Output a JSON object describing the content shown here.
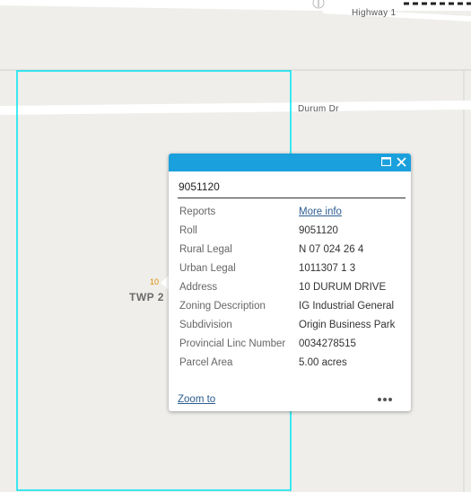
{
  "map": {
    "road_highway_label": "Highway 1",
    "road_durum_label": "Durum Dr",
    "township_label": "TWP 2",
    "lot_number": "10"
  },
  "popup": {
    "title": "9051120",
    "zoom_to_label": "Zoom to",
    "attributes": [
      {
        "name": "Reports",
        "value": "More info",
        "is_link": true
      },
      {
        "name": "Roll",
        "value": "9051120"
      },
      {
        "name": "Rural Legal",
        "value": "N 07 024 26 4"
      },
      {
        "name": "Urban Legal",
        "value": "1011307 1 3"
      },
      {
        "name": "Address",
        "value": "10 DURUM DRIVE"
      },
      {
        "name": "Zoning Description",
        "value": "IG Industrial General"
      },
      {
        "name": "Subdivision",
        "value": "Origin Business Park"
      },
      {
        "name": "Provincial Linc Number",
        "value": "0034278515"
      },
      {
        "name": "Parcel Area",
        "value": "5.00 acres"
      }
    ]
  },
  "colors": {
    "popup_header": "#1aa0dc",
    "parcel_highlight": "#00e5f0",
    "lot_number": "#e08a00"
  },
  "icons": {
    "maximize": "maximize-icon",
    "close": "close-icon",
    "more": "ellipsis-icon"
  }
}
